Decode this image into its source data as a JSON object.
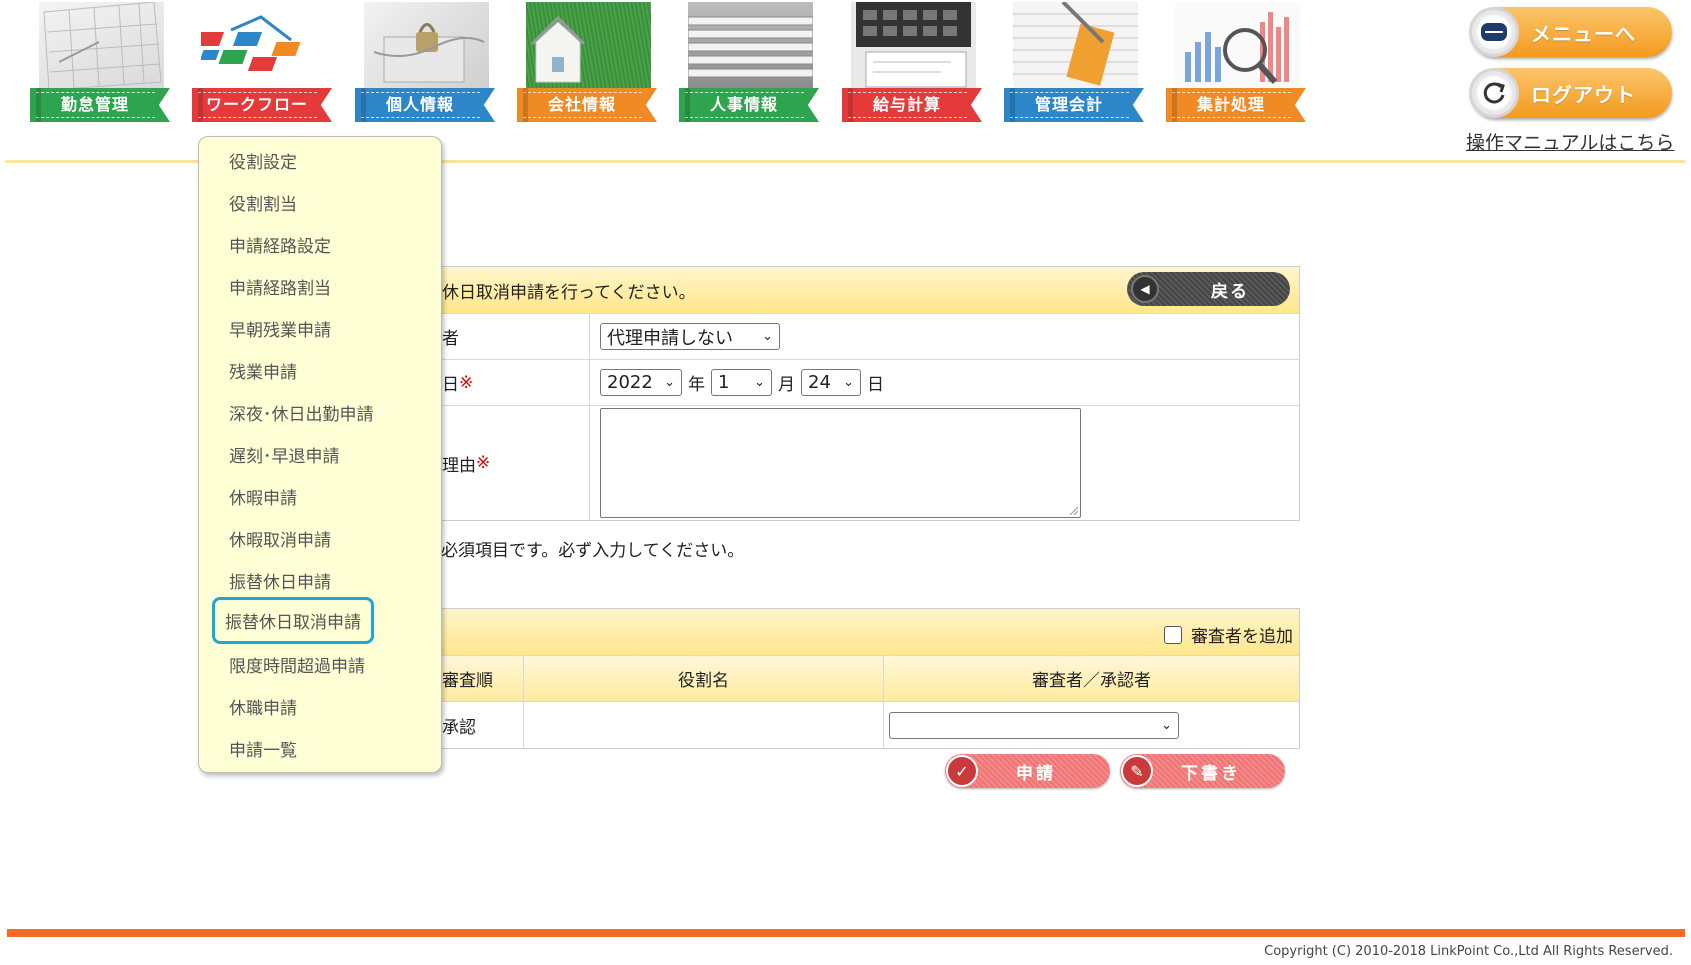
{
  "nav": {
    "items": [
      {
        "label": "勤怠管理",
        "color": "#2fa44e",
        "icon": "calendar-photo"
      },
      {
        "label": "ワークフロー",
        "color": "#e53a3a",
        "icon": "workflow-blocks"
      },
      {
        "label": "個人情報",
        "color": "#2d86c8",
        "icon": "padlock-photo"
      },
      {
        "label": "会社情報",
        "color": "#f08a24",
        "icon": "house-on-grass"
      },
      {
        "label": "人事情報",
        "color": "#2fa44e",
        "icon": "file-folders"
      },
      {
        "label": "給与計算",
        "color": "#e53a3a",
        "icon": "calculator-photo"
      },
      {
        "label": "管理会計",
        "color": "#2d86c8",
        "icon": "ledger-photo"
      },
      {
        "label": "集計処理",
        "color": "#f08a24",
        "icon": "chart-magnifier"
      }
    ],
    "menu_button": "メニューへ",
    "logout_button": "ログアウト",
    "manual_link": "操作マニュアルはこちら"
  },
  "dropdown": {
    "items": [
      "役割設定",
      "役割割当",
      "申請経路設定",
      "申請経路割当",
      "早朝残業申請",
      "残業申請",
      "深夜･休日出勤申請",
      "遅刻･早退申請",
      "休暇申請",
      "休暇取消申請",
      "振替休日申請",
      "振替休日取消申請",
      "限度時間超過申請",
      "休職申請",
      "申請一覧"
    ],
    "active": "振替休日取消申請"
  },
  "form": {
    "intro": "休日取消申請を行ってください。",
    "back_button": "戻る",
    "rows": {
      "applicant_label": "者",
      "applicant_value": "代理申請しない",
      "date_label": "日",
      "required_mark": "※",
      "year": "2022",
      "year_unit": "年",
      "month": "1",
      "month_unit": "月",
      "day": "24",
      "day_unit": "日",
      "reason_label": "理由"
    },
    "required_note": "必須項目です。必ず入力してください。"
  },
  "approvers": {
    "add_reviewer_label": "審査者を追加",
    "add_reviewer_checked": false,
    "columns": [
      "審査順",
      "役割名",
      "審査者／承認者"
    ],
    "rows": [
      {
        "order": "承認",
        "role": "",
        "approver": ""
      }
    ]
  },
  "actions": {
    "submit": "申請",
    "draft": "下書き"
  },
  "footer": {
    "copyright": "Copyright (C) 2010-2018 LinkPoint Co.,Ltd All Rights Reserved."
  }
}
